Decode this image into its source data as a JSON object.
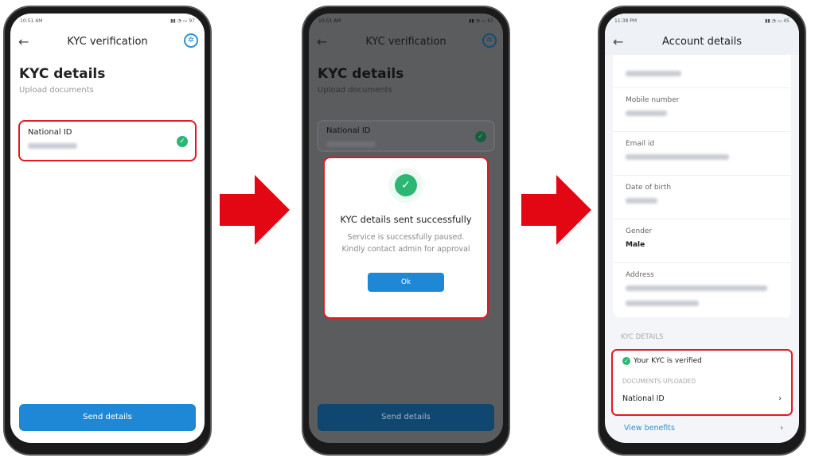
{
  "colors": {
    "accent": "#1e88d6",
    "success": "#2bb673",
    "highlight": "#e01b24",
    "arrow": "#e30613"
  },
  "screen1": {
    "time": "10:51 AM",
    "battery": "97",
    "title": "KYC verification",
    "heading": "KYC details",
    "subheading": "Upload documents",
    "document": "National ID",
    "button": "Send details",
    "icons": [
      "back-arrow-icon",
      "help-icon",
      "check-circle-icon"
    ]
  },
  "screen2": {
    "time": "10:51 AM",
    "battery": "97",
    "title": "KYC verification",
    "heading": "KYC details",
    "subheading": "Upload documents",
    "document": "National ID",
    "button": "Send details",
    "modal": {
      "title": "KYC details sent successfully",
      "message": "Service is successfully paused. Kindly contact admin for approval",
      "ok": "Ok"
    }
  },
  "screen3": {
    "time": "11:38 PM",
    "battery": "45",
    "title": "Account details",
    "fields": [
      {
        "label": "Mobile number"
      },
      {
        "label": "Email id"
      },
      {
        "label": "Date of birth"
      },
      {
        "label": "Gender",
        "value": "Male"
      },
      {
        "label": "Address"
      }
    ],
    "kyc_section": "KYC DETAILS",
    "kyc_status": "Your KYC is verified",
    "docs_label": "DOCUMENTS UPLOADED",
    "document": "National ID",
    "view_benefits": "View benefits"
  }
}
